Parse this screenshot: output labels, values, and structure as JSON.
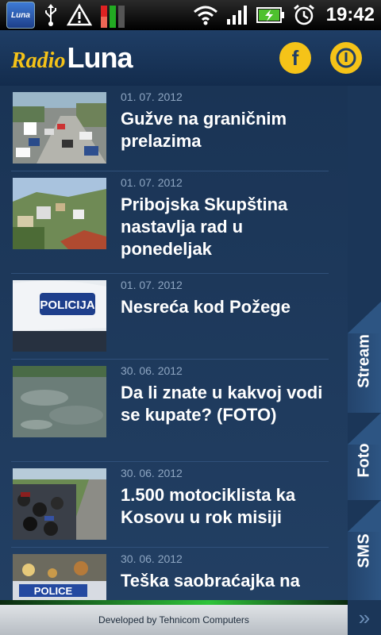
{
  "status_bar": {
    "app_icon_label": "Luna",
    "time": "19:42"
  },
  "header": {
    "logo_radio": "Radio",
    "logo_luna": "Luna",
    "facebook_glyph": "f",
    "accent_color": "#f5c318"
  },
  "news": [
    {
      "date": "01. 07. 2012",
      "title": "Gužve na graničnim prelazima",
      "thumb": "traffic-jam-photo"
    },
    {
      "date": "01. 07. 2012",
      "title": "Pribojska Skupština nastavlja rad u ponedeljak",
      "thumb": "town-panorama-photo"
    },
    {
      "date": "01. 07. 2012",
      "title": "Nesreća kod Požege",
      "thumb": "police-car-photo",
      "thumb_text": "POLICIJA"
    },
    {
      "date": "30. 06. 2012",
      "title": "Da li znate u kakvoj vodi se kupate? (FOTO)",
      "thumb": "water-photo"
    },
    {
      "date": "30. 06. 2012",
      "title": "1.500 motociklista ka Kosovu u rok misiji",
      "thumb": "motorcycles-photo"
    },
    {
      "date": "30. 06. 2012",
      "title": "Teška saobraćajka na",
      "thumb": "police-lights-photo",
      "thumb_text": "POLICE"
    }
  ],
  "side_tabs": [
    "Stream",
    "Foto",
    "SMS"
  ],
  "more_glyph": "»",
  "footer": {
    "text": "Developed by Tehnicom Computers"
  }
}
